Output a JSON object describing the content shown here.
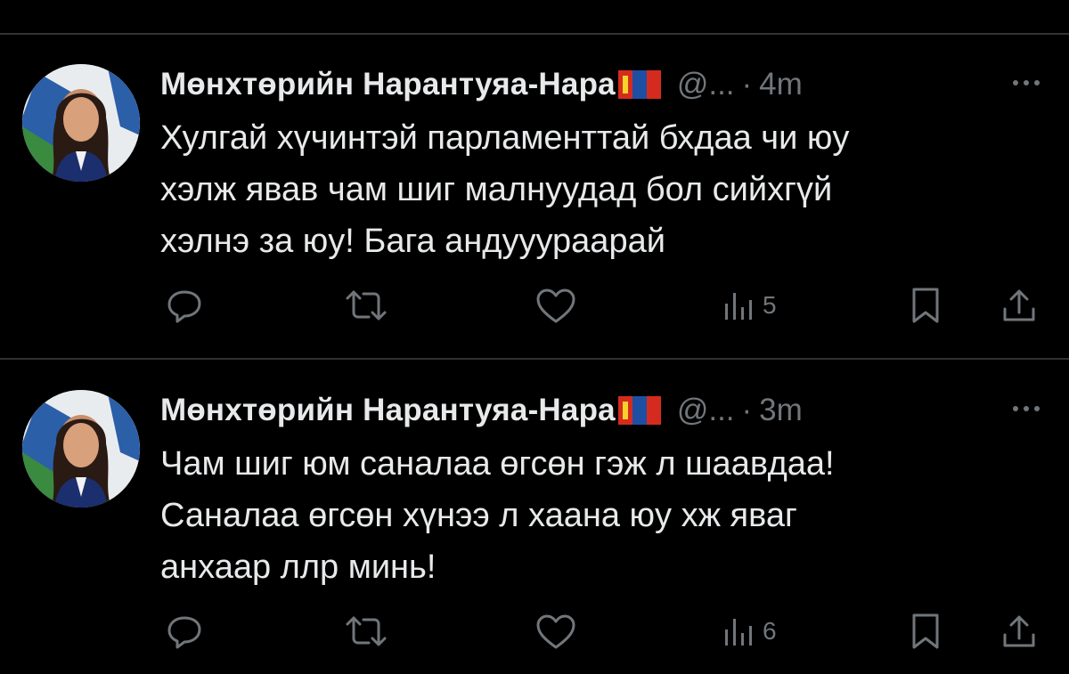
{
  "tweets": [
    {
      "display_name": "Мөнхтөрийн Нарантуяа-Нара",
      "handle": "@...",
      "separator": "·",
      "time": "4m",
      "lines": [
        "Хулгай хүчинтэй парламенттай бхдаа чи юу",
        "хэлж явав чам шиг малнуудад бол сийхгүй",
        "хэлнэ за юу! Бага андууураарай"
      ],
      "views": "5"
    },
    {
      "display_name": "Мөнхтөрийн Нарантуяа-Нара",
      "handle": "@...",
      "separator": "·",
      "time": "3m",
      "lines": [
        "Чам шиг юм саналаа өгсөн гэж л шаавдаа!",
        "Саналаа өгсөн хүнээ л хаана юу хж яваг",
        "анхаар ллр минь!"
      ],
      "views": "6"
    }
  ],
  "icons": {
    "reply": "reply-icon",
    "retweet": "retweet-icon",
    "like": "heart-icon",
    "views": "views-chart-icon",
    "bookmark": "bookmark-icon",
    "share": "share-icon",
    "more": "more-dots-icon",
    "flag": "mongolian-flag-icon"
  },
  "colors": {
    "background": "#000000",
    "text_primary": "#e7e9ea",
    "text_secondary": "#71767b",
    "divider": "#2f3336"
  }
}
